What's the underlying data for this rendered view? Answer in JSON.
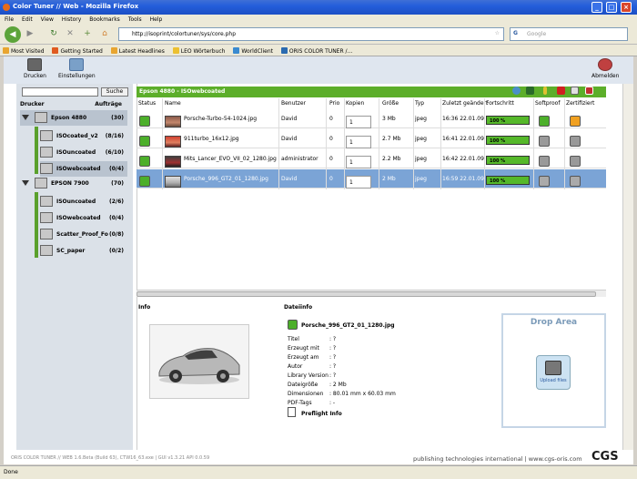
{
  "window": {
    "title": "Color Tuner // Web - Mozilla Firefox"
  },
  "menu": [
    "File",
    "Edit",
    "View",
    "History",
    "Bookmarks",
    "Tools",
    "Help"
  ],
  "nav": {
    "url": "http://isoprint/colortuner/sys/core.php",
    "search_placeholder": "Google"
  },
  "bookmarks": [
    "Most Visited",
    "Getting Started",
    "Latest Headlines",
    "LEO Wörterbuch",
    "WorldClient",
    "ORIS COLOR TUNER /..."
  ],
  "toolbar": {
    "print_label": "Drucken",
    "settings_label": "Einstellungen",
    "logout_label": "Abmelden"
  },
  "sidebar": {
    "search_button": "Suche",
    "col_printer": "Drucker",
    "col_jobs": "Aufträge",
    "tree": [
      {
        "label": "Epson 4880",
        "count": "(30)"
      },
      {
        "label": "ISOcoated_v2",
        "count": "(8/16)"
      },
      {
        "label": "ISOuncoated",
        "count": "(6/10)"
      },
      {
        "label": "ISOwebcoated",
        "count": "(0/4)"
      },
      {
        "label": "EPSON 7900",
        "count": "(70)"
      },
      {
        "label": "ISOuncoated",
        "count": "(2/6)"
      },
      {
        "label": "ISOwebcoated",
        "count": "(0/4)"
      },
      {
        "label": "Scatter_Proof_Fo",
        "count": "(0/8)"
      },
      {
        "label": "SC_paper",
        "count": "(0/2)"
      }
    ]
  },
  "queue": {
    "header": "Epson 4880 - ISOwebcoated",
    "columns": [
      "Status",
      "Name",
      "Benutzer",
      "Prio",
      "Kopien",
      "Größe",
      "Typ",
      "Zuletzt geändert",
      "Fortschritt",
      "Softproof",
      "Zertifiziert"
    ],
    "rows": [
      {
        "name": "Porsche-Turbo-54-1024.jpg",
        "user": "David",
        "prio": "0",
        "copies": "1",
        "size": "3 Mb",
        "type": "jpeg",
        "modified": "16:36 22.01.09",
        "progress_text": "100 %",
        "progress": 1.0
      },
      {
        "name": "911turbo_16x12.jpg",
        "user": "David",
        "prio": "0",
        "copies": "1",
        "size": "2.7 Mb",
        "type": "jpeg",
        "modified": "16:41 22.01.09",
        "progress_text": "100 %",
        "progress": 1.0
      },
      {
        "name": "Mits_Lancer_EVO_VII_02_1280.jpg",
        "user": "administrator",
        "prio": "0",
        "copies": "1",
        "size": "2.2 Mb",
        "type": "jpeg",
        "modified": "16:42 22.01.09",
        "progress_text": "100 %",
        "progress": 1.0
      },
      {
        "name": "Porsche_996_GT2_01_1280.jpg",
        "user": "David",
        "prio": "0",
        "copies": "1",
        "size": "2 Mb",
        "type": "jpeg",
        "modified": "16:59 22.01.09",
        "progress_text": "100 %",
        "progress": 1.0
      }
    ]
  },
  "info": {
    "info_title": "Info",
    "file_title": "Dateiinfo",
    "filename": "Porsche_996_GT2_01_1280.jpg",
    "fields": [
      {
        "label": "Titel",
        "value": ": ?"
      },
      {
        "label": "Erzeugt mit",
        "value": ": ?"
      },
      {
        "label": "Erzeugt am",
        "value": ": ?"
      },
      {
        "label": "Autor",
        "value": ": ?"
      },
      {
        "label": "Library Version",
        "value": ": ?"
      },
      {
        "label": "Dateigröße",
        "value": ": 2 Mb"
      },
      {
        "label": "Dimensionen",
        "value": ": 80.01 mm x 60.03 mm"
      },
      {
        "label": "PDF-Tags",
        "value": ": -"
      }
    ],
    "preflight": "Preflight Info"
  },
  "drop": {
    "title": "Drop Area",
    "upload": "Upload files"
  },
  "footer": {
    "version": "ORIS COLOR TUNER // WEB 1.6.Beta (Build 63), CTW16_63.exe | GUI v1.3.21 API 0.0.59",
    "company": "publishing technologies international | www.cgs-oris.com",
    "logo": "CGS"
  },
  "status": "Done",
  "colors": {
    "accent_green": "#5cae2a",
    "selection": "#7ba4d6",
    "xp_blue": "#245edb"
  }
}
